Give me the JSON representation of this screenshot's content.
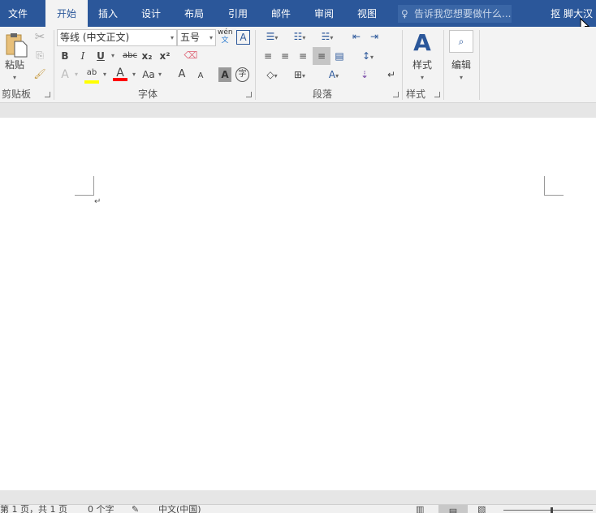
{
  "tabs": [
    {
      "label": "文件",
      "active": false
    },
    {
      "label": "开始",
      "active": true
    },
    {
      "label": "插入",
      "active": false
    },
    {
      "label": "设计",
      "active": false
    },
    {
      "label": "布局",
      "active": false
    },
    {
      "label": "引用",
      "active": false
    },
    {
      "label": "邮件",
      "active": false
    },
    {
      "label": "审阅",
      "active": false
    },
    {
      "label": "视图",
      "active": false
    }
  ],
  "tell_me": "告诉我您想要做什么...",
  "user": "抠 脚大汉",
  "clipboard": {
    "paste": "粘贴",
    "group": "剪贴板"
  },
  "font": {
    "name": "等线 (中文正文)",
    "size": "五号",
    "group": "字体",
    "bold": "B",
    "italic": "I",
    "underline": "U",
    "strike": "abc",
    "sub": "x₂",
    "sup": "x²",
    "case": "Aa",
    "grow": "A",
    "shrink": "A",
    "shade": "A",
    "enclose": "字",
    "wen": "wén",
    "wen2": "文",
    "border": "A",
    "effect": "A",
    "highlight": "ab",
    "color": "A"
  },
  "paragraph": {
    "group": "段落"
  },
  "styles": {
    "label": "样式",
    "group": "样式"
  },
  "editing": {
    "label": "编辑"
  },
  "colors": {
    "accent": "#2b579a",
    "highlight": "#ffff00",
    "font_color": "#ff0000"
  },
  "status": {
    "page": "第 1 页，共 1 页",
    "words": "0 个字",
    "language": "中文(中国)"
  },
  "paragraph_mark": "↵"
}
